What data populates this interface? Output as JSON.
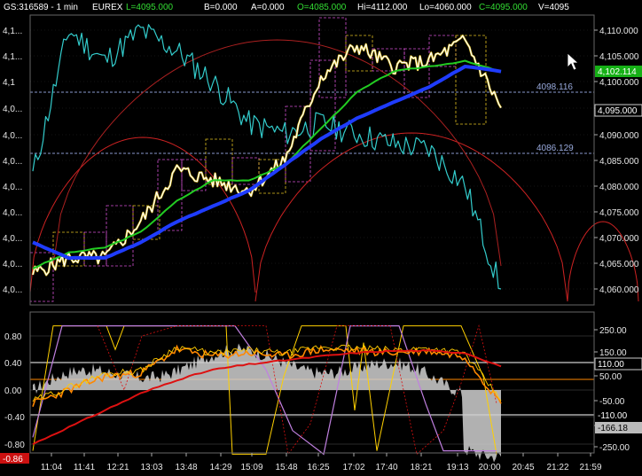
{
  "header": {
    "symbol": "GS:316589 - 1 min",
    "exchange": "EUREX",
    "last": "L=4095.000",
    "bid": "B=0.000",
    "ask": "A=0.000",
    "open": "O=4085.000",
    "high": "Hi=4112.000",
    "low": "Lo=4060.000",
    "close": "C=4095.000",
    "volume": "V=4095"
  },
  "colors": {
    "background": "#000000",
    "grid": "#ffffff",
    "price": "#ffffff",
    "cyan_line": "#33cccc",
    "green_ma": "#22cc22",
    "blue_ma": "#1f3cff",
    "red_ma": "#cc2222",
    "box_magenta": "#d24fd2",
    "box_yellow": "#e0c020",
    "hline": "#8899cc",
    "osc_orange": "#ff8800",
    "osc_yellow": "#ffd000",
    "osc_red": "#dd1111",
    "osc_violet": "#c080e0",
    "histogram": "#d0d0d0"
  },
  "price_panel": {
    "left_ticks": [
      "4,1...",
      "4,1...",
      "4,1",
      "4,0...",
      "4,0...",
      "4,0...",
      "4,0...",
      "4,0...",
      "4,0...",
      "4,0...",
      "4,0..."
    ],
    "right_ticks": [
      "4,110.000",
      "4,105.000",
      "4,100.000",
      "4,095.000",
      "4,090.000",
      "4,085.000",
      "4,080.000",
      "4,075.000",
      "4,070.000",
      "4,065.000",
      "4,060.000"
    ],
    "hline_upper": "4098.116",
    "hline_lower": "4086.129",
    "tag_ma": "4,102.114",
    "tag_last": "4,095.000"
  },
  "osc_panel": {
    "left_ticks": [
      "0.80",
      "0.40",
      "0.00",
      "-0.40",
      "-0.80"
    ],
    "left_tag": "-0.86",
    "right_ticks": [
      "250.00",
      "150.00",
      "50.00",
      "-50.00",
      "-150.00",
      "-250.00"
    ],
    "tag_upper": "110.00",
    "tag_mid": "-110.00",
    "tag_lower": "-166.18"
  },
  "time_axis": [
    "11:04",
    "11:41",
    "12:21",
    "13:03",
    "13:48",
    "14:29",
    "15:09",
    "15:48",
    "16:25",
    "17:02",
    "17:40",
    "18:21",
    "19:13",
    "20:00",
    "20:45",
    "21:22",
    "21:59"
  ],
  "chart_data": {
    "type": "line",
    "interval": "1 min",
    "x": [
      "11:04",
      "11:41",
      "12:21",
      "13:03",
      "13:48",
      "14:29",
      "15:09",
      "15:48",
      "16:25",
      "17:02",
      "17:40",
      "18:21",
      "19:13",
      "20:00"
    ],
    "ylim": [
      4058,
      4115
    ],
    "series": [
      {
        "key": "price",
        "values": [
          4063,
          4066,
          4066,
          4073,
          4083,
          4081,
          4079,
          4085,
          4101,
          4107,
          4103,
          4104,
          4108,
          4095
        ]
      },
      {
        "key": "green_ma",
        "values": [
          4064,
          4067,
          4068,
          4071,
          4077,
          4081,
          4081,
          4084,
          4091,
          4098,
          4102,
          4103,
          4104,
          4102
        ]
      },
      {
        "key": "blue_ma",
        "values": [
          4069,
          4066,
          4066,
          4069,
          4073,
          4076,
          4079,
          4084,
          4089,
          4093,
          4096,
          4099,
          4103,
          4102
        ]
      },
      {
        "key": "cyan_line",
        "values": [
          4082,
          4110,
          4104,
          4110,
          4106,
          4100,
          4092,
          4090,
          4092,
          4090,
          4088,
          4087,
          4080,
          4060
        ]
      }
    ],
    "osc_ylim": [
      -1.0,
      1.0
    ],
    "osc_series": [
      {
        "key": "osc_orange",
        "values": [
          -0.2,
          0.0,
          0.2,
          0.25,
          0.6,
          0.5,
          0.55,
          0.5,
          0.6,
          0.58,
          0.55,
          0.58,
          0.5,
          -0.2
        ]
      },
      {
        "key": "osc_red",
        "values": [
          -0.8,
          -0.55,
          -0.3,
          -0.05,
          0.15,
          0.3,
          0.38,
          0.44,
          0.5,
          0.55,
          0.58,
          0.58,
          0.55,
          0.35
        ]
      }
    ]
  }
}
